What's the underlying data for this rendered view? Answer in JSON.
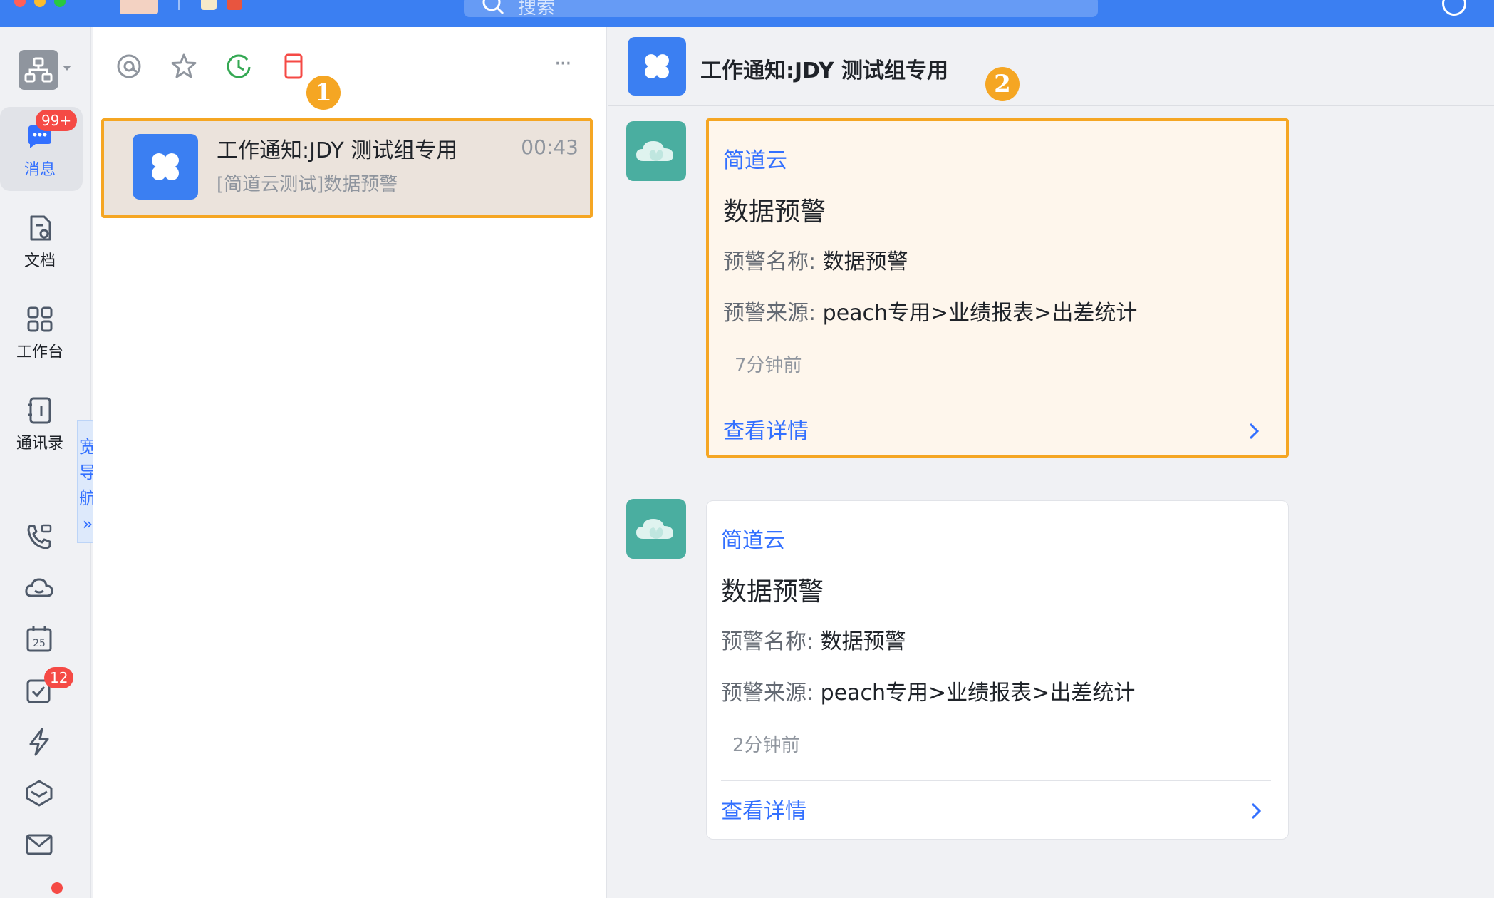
{
  "colors": {
    "titlebar": "#3b7ff2",
    "accent": "#3370ff",
    "highlight_border": "#f5a623",
    "badge_red": "#f54a45",
    "bot_avatar": "#4aaea0",
    "highlight_card_bg": "#fef6ec",
    "selected_conversation_bg": "#ebe3dc"
  },
  "titlebar": {
    "search_placeholder": "搜索"
  },
  "sidebar": {
    "items": [
      {
        "label": "消息",
        "icon": "message-icon",
        "badge": "99+",
        "active": true
      },
      {
        "label": "文档",
        "icon": "document-icon"
      },
      {
        "label": "工作台",
        "icon": "workspace-grid-icon"
      },
      {
        "label": "通讯录",
        "icon": "contacts-icon"
      }
    ],
    "wide_nav_label": "宽导航",
    "wide_nav_expand": "»",
    "extra_icons": [
      "call-icon",
      "cloud-icon",
      "calendar-icon",
      "todo-icon",
      "flash-icon",
      "layers-icon",
      "mail-icon"
    ],
    "calendar_day": "25",
    "todo_badge": "12"
  },
  "conversation_list": {
    "filter_icons": [
      "mention-icon",
      "star-icon",
      "clock-icon",
      "bookmark-icon"
    ],
    "more_label": "···",
    "annotation": "1",
    "items": [
      {
        "title": "工作通知:JDY 测试组专用",
        "time": "00:43",
        "preview": "[简道云测试]数据预警",
        "selected": true
      }
    ]
  },
  "chat": {
    "title": "工作通知:JDY 测试组专用",
    "annotation": "2",
    "messages": [
      {
        "source": "简道云",
        "title": "数据预警",
        "name_label": "预警名称: ",
        "name_value": "数据预警",
        "source_label": "预警来源: ",
        "source_value": "peach专用>业绩报表>出差统计",
        "time": "7分钟前",
        "detail_label": "查看详情",
        "highlighted": true
      },
      {
        "source": "简道云",
        "title": "数据预警",
        "name_label": "预警名称: ",
        "name_value": "数据预警",
        "source_label": "预警来源: ",
        "source_value": "peach专用>业绩报表>出差统计",
        "time": "2分钟前",
        "detail_label": "查看详情",
        "highlighted": false
      }
    ]
  }
}
